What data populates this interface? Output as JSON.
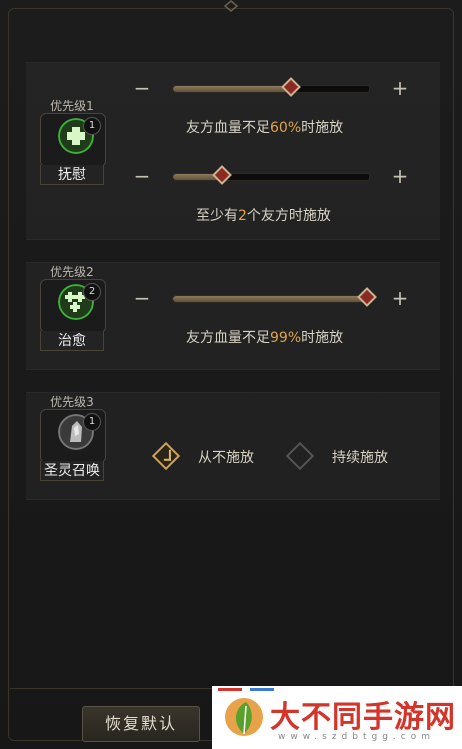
{
  "rows": [
    {
      "priority": "优先级1",
      "skill": "抚慰",
      "count": "1",
      "sliders": [
        {
          "value": 0.6,
          "caption_pre": "友方血量不足",
          "caption_hl": "60%",
          "caption_post": "时施放"
        },
        {
          "value": 0.25,
          "caption_pre": "至少有",
          "caption_hl": "2",
          "caption_post": "个友方时施放"
        }
      ]
    },
    {
      "priority": "优先级2",
      "skill": "治愈",
      "count": "2",
      "sliders": [
        {
          "value": 0.99,
          "caption_pre": "友方血量不足",
          "caption_hl": "99%",
          "caption_post": "时施放"
        }
      ]
    },
    {
      "priority": "优先级3",
      "skill": "圣灵召唤",
      "count": "1",
      "options": [
        {
          "label": "从不施放",
          "selected": true
        },
        {
          "label": "持续施放",
          "selected": false
        }
      ]
    }
  ],
  "buttons": {
    "minus": "−",
    "plus": "+",
    "reset": "恢复默认"
  },
  "watermark": {
    "title": "大不同手游网",
    "url": "www.szdbtgg.com"
  },
  "colors": {
    "highlight": "#e0a34a",
    "heal_icon": "#3fae3a"
  }
}
